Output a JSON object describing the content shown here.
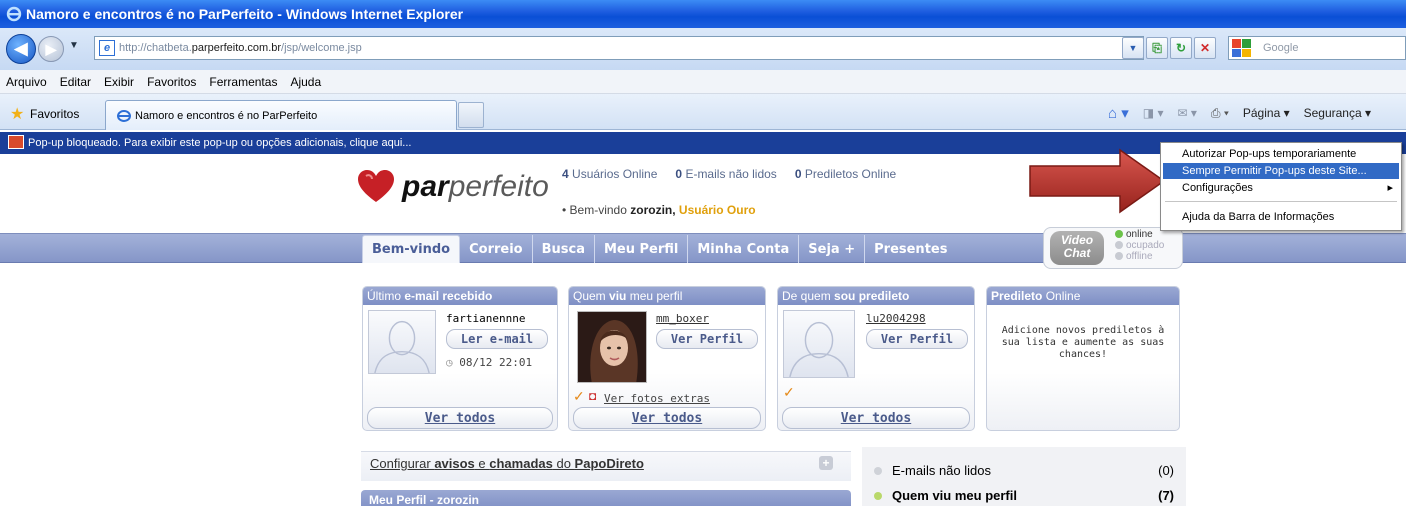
{
  "window": {
    "title": "Namoro e encontros é no ParPerfeito - Windows Internet Explorer"
  },
  "address": {
    "url_prefix": "http://chatbeta.",
    "url_host": "parperfeito.com.br",
    "url_path": "/jsp/welcome.jsp",
    "search_placeholder": "Google"
  },
  "menu": [
    "Arquivo",
    "Editar",
    "Exibir",
    "Favoritos",
    "Ferramentas",
    "Ajuda"
  ],
  "favorites_bar": {
    "favorites_label": "Favoritos",
    "tab_title": "Namoro e encontros é no ParPerfeito",
    "page_menu": "Página ▾",
    "security_menu": "Segurança ▾"
  },
  "infobar": {
    "text": "Pop-up bloqueado. Para exibir este pop-up ou opções adicionais, clique aqui..."
  },
  "context_menu": {
    "items": [
      "Autorizar Pop-ups temporariamente",
      "Sempre Permitir Pop-ups deste Site...",
      "Configurações",
      "Ajuda da Barra de Informações"
    ],
    "highlighted_index": 1,
    "submenu_arrow": "▸"
  },
  "site": {
    "logo_bold": "par",
    "logo_light": "perfeito",
    "stats": [
      {
        "count": "4",
        "label": "Usuários Online"
      },
      {
        "count": "0",
        "label": "E-mails não lidos"
      },
      {
        "count": "0",
        "label": "Prediletos Online"
      }
    ],
    "welcome_prefix": "• Bem-vindo",
    "username": "zorozin,",
    "membership": "Usuário Ouro",
    "nav_tabs": [
      "Bem-vindo",
      "Correio",
      "Busca",
      "Meu Perfil",
      "Minha Conta",
      "Seja +",
      "Presentes"
    ],
    "video_chat": {
      "line1": "Video",
      "line2": "Chat",
      "statuses": [
        "online",
        "ocupado",
        "offline"
      ]
    }
  },
  "cards": {
    "email": {
      "title_prefix": "Último ",
      "title_bold": "e-mail recebido",
      "sender": "fartianennne",
      "button": "Ler e-mail",
      "timestamp": "08/12 22:01",
      "see_all": "Ver todos"
    },
    "viewed": {
      "title_prefix": "Quem ",
      "title_bold": "viu",
      "title_suffix": " meu perfil",
      "user": "mm_boxer",
      "button": "Ver Perfil",
      "extra_photos": "Ver fotos extras",
      "see_all": "Ver todos"
    },
    "favorite_of": {
      "title_prefix": "De quem ",
      "title_bold": "sou predileto",
      "user": "lu2004298",
      "button": "Ver Perfil",
      "see_all": "Ver todos"
    },
    "favorites_online": {
      "title_bold": "Predileto",
      "title_suffix": " Online",
      "message": "Adicione novos prediletos à sua lista e aumente as suas chances!"
    }
  },
  "lower": {
    "config_prefix": "Configurar ",
    "config_b1": "avisos",
    "config_mid": " e ",
    "config_b2": "chamadas",
    "config_mid2": " do ",
    "config_b3": "PapoDireto",
    "perfil_bar": "Meu Perfil - zorozin",
    "right_rows": [
      {
        "label": "E-mails não lidos",
        "count": "(0)",
        "bold": false
      },
      {
        "label": "Quem viu meu perfil",
        "count": "(7)",
        "bold": true
      }
    ]
  },
  "colors": {
    "title_bar": "#1f5ee0",
    "infobar": "#1a3f99",
    "nav_band": "#8596c8",
    "gold": "#e0a00c",
    "highlight": "#316ac5",
    "arrow": "#b8332b"
  }
}
